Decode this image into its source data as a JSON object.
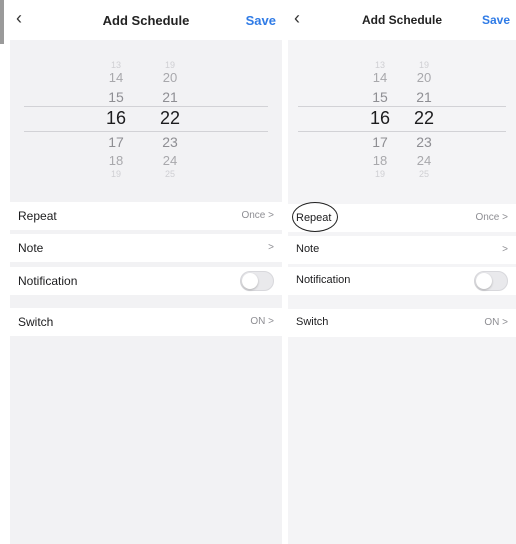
{
  "screens": [
    {
      "header": {
        "back_icon": "chevron-left-icon",
        "title": "Add Schedule",
        "save_label": "Save"
      },
      "picker": {
        "hours": [
          "13",
          "14",
          "15",
          "16",
          "17",
          "18",
          "19"
        ],
        "minutes": [
          "19",
          "20",
          "21",
          "22",
          "23",
          "24",
          "25"
        ],
        "selected_hour": "16",
        "selected_minute": "22"
      },
      "rows": {
        "repeat": {
          "label": "Repeat",
          "value": "Once"
        },
        "note": {
          "label": "Note",
          "value": ""
        },
        "notification": {
          "label": "Notification",
          "enabled": false
        },
        "switch": {
          "label": "Switch",
          "value": "ON"
        }
      },
      "chevron": ">"
    },
    {
      "header": {
        "back_icon": "chevron-left-icon",
        "title": "Add Schedule",
        "save_label": "Save"
      },
      "picker": {
        "hours": [
          "13",
          "14",
          "15",
          "16",
          "17",
          "18",
          "19"
        ],
        "minutes": [
          "19",
          "20",
          "21",
          "22",
          "23",
          "24",
          "25"
        ],
        "selected_hour": "16",
        "selected_minute": "22"
      },
      "rows": {
        "repeat": {
          "label": "Repeat",
          "value": "Once",
          "annotation": "hand-drawn-circle"
        },
        "note": {
          "label": "Note",
          "value": ""
        },
        "notification": {
          "label": "Notification",
          "enabled": false
        },
        "switch": {
          "label": "Switch",
          "value": "ON"
        }
      },
      "chevron": ">"
    }
  ],
  "colors": {
    "accent": "#2f7be6",
    "background": "#f2f2f4",
    "row": "#ffffff",
    "muted": "#8e8e93"
  }
}
